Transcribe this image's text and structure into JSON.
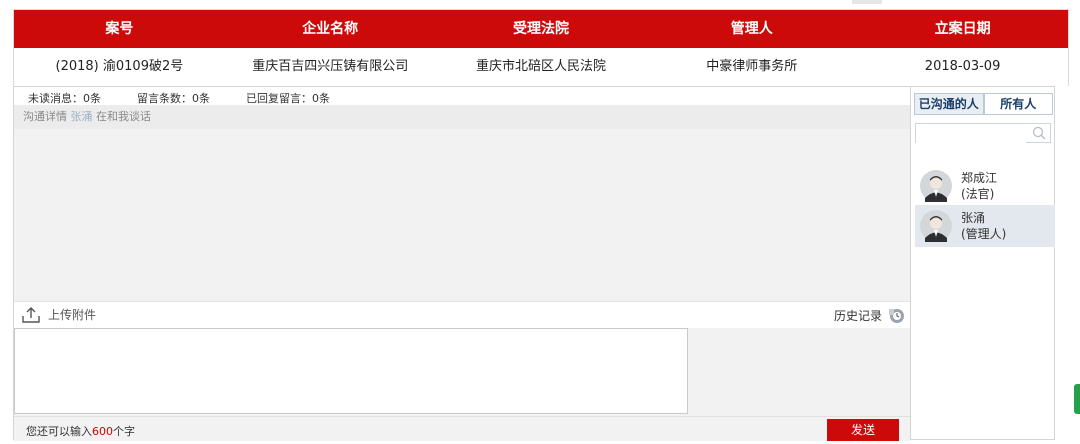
{
  "case_table": {
    "headers": [
      "案号",
      "企业名称",
      "受理法院",
      "管理人",
      "立案日期"
    ],
    "row": [
      "(2018) 渝0109破2号",
      "重庆百吉四兴压铸有限公司",
      "重庆市北碚区人民法院",
      "中豪律师事务所",
      "2018-03-09"
    ]
  },
  "stats": {
    "unread": "未读消息：0条",
    "messages": "留言条数：0条",
    "replied": "已回复留言：0条"
  },
  "chat": {
    "title_prefix": "沟通详情",
    "title_name": "张涌",
    "title_suffix": "在和我谈话"
  },
  "toolbar": {
    "upload_label": "上传附件",
    "history_label": "历史记录",
    "upload_icon": "upload-icon",
    "history_icon": "history-icon"
  },
  "footer": {
    "remaining_prefix": "您还可以输入",
    "remaining_count": "600",
    "remaining_suffix": "个字",
    "send_label": "发送"
  },
  "contacts": {
    "tabs": [
      "已沟通的人",
      "所有人"
    ],
    "active_tab": "所有人",
    "search_placeholder": "",
    "list": [
      {
        "name": "郑成江",
        "role": "(法官)"
      },
      {
        "name": "张涌",
        "role": "(管理人)"
      }
    ]
  },
  "colors": {
    "brand_red": "#cc0a0a",
    "count_red": "#d40000",
    "tab_blue": "#1b3f6b"
  }
}
